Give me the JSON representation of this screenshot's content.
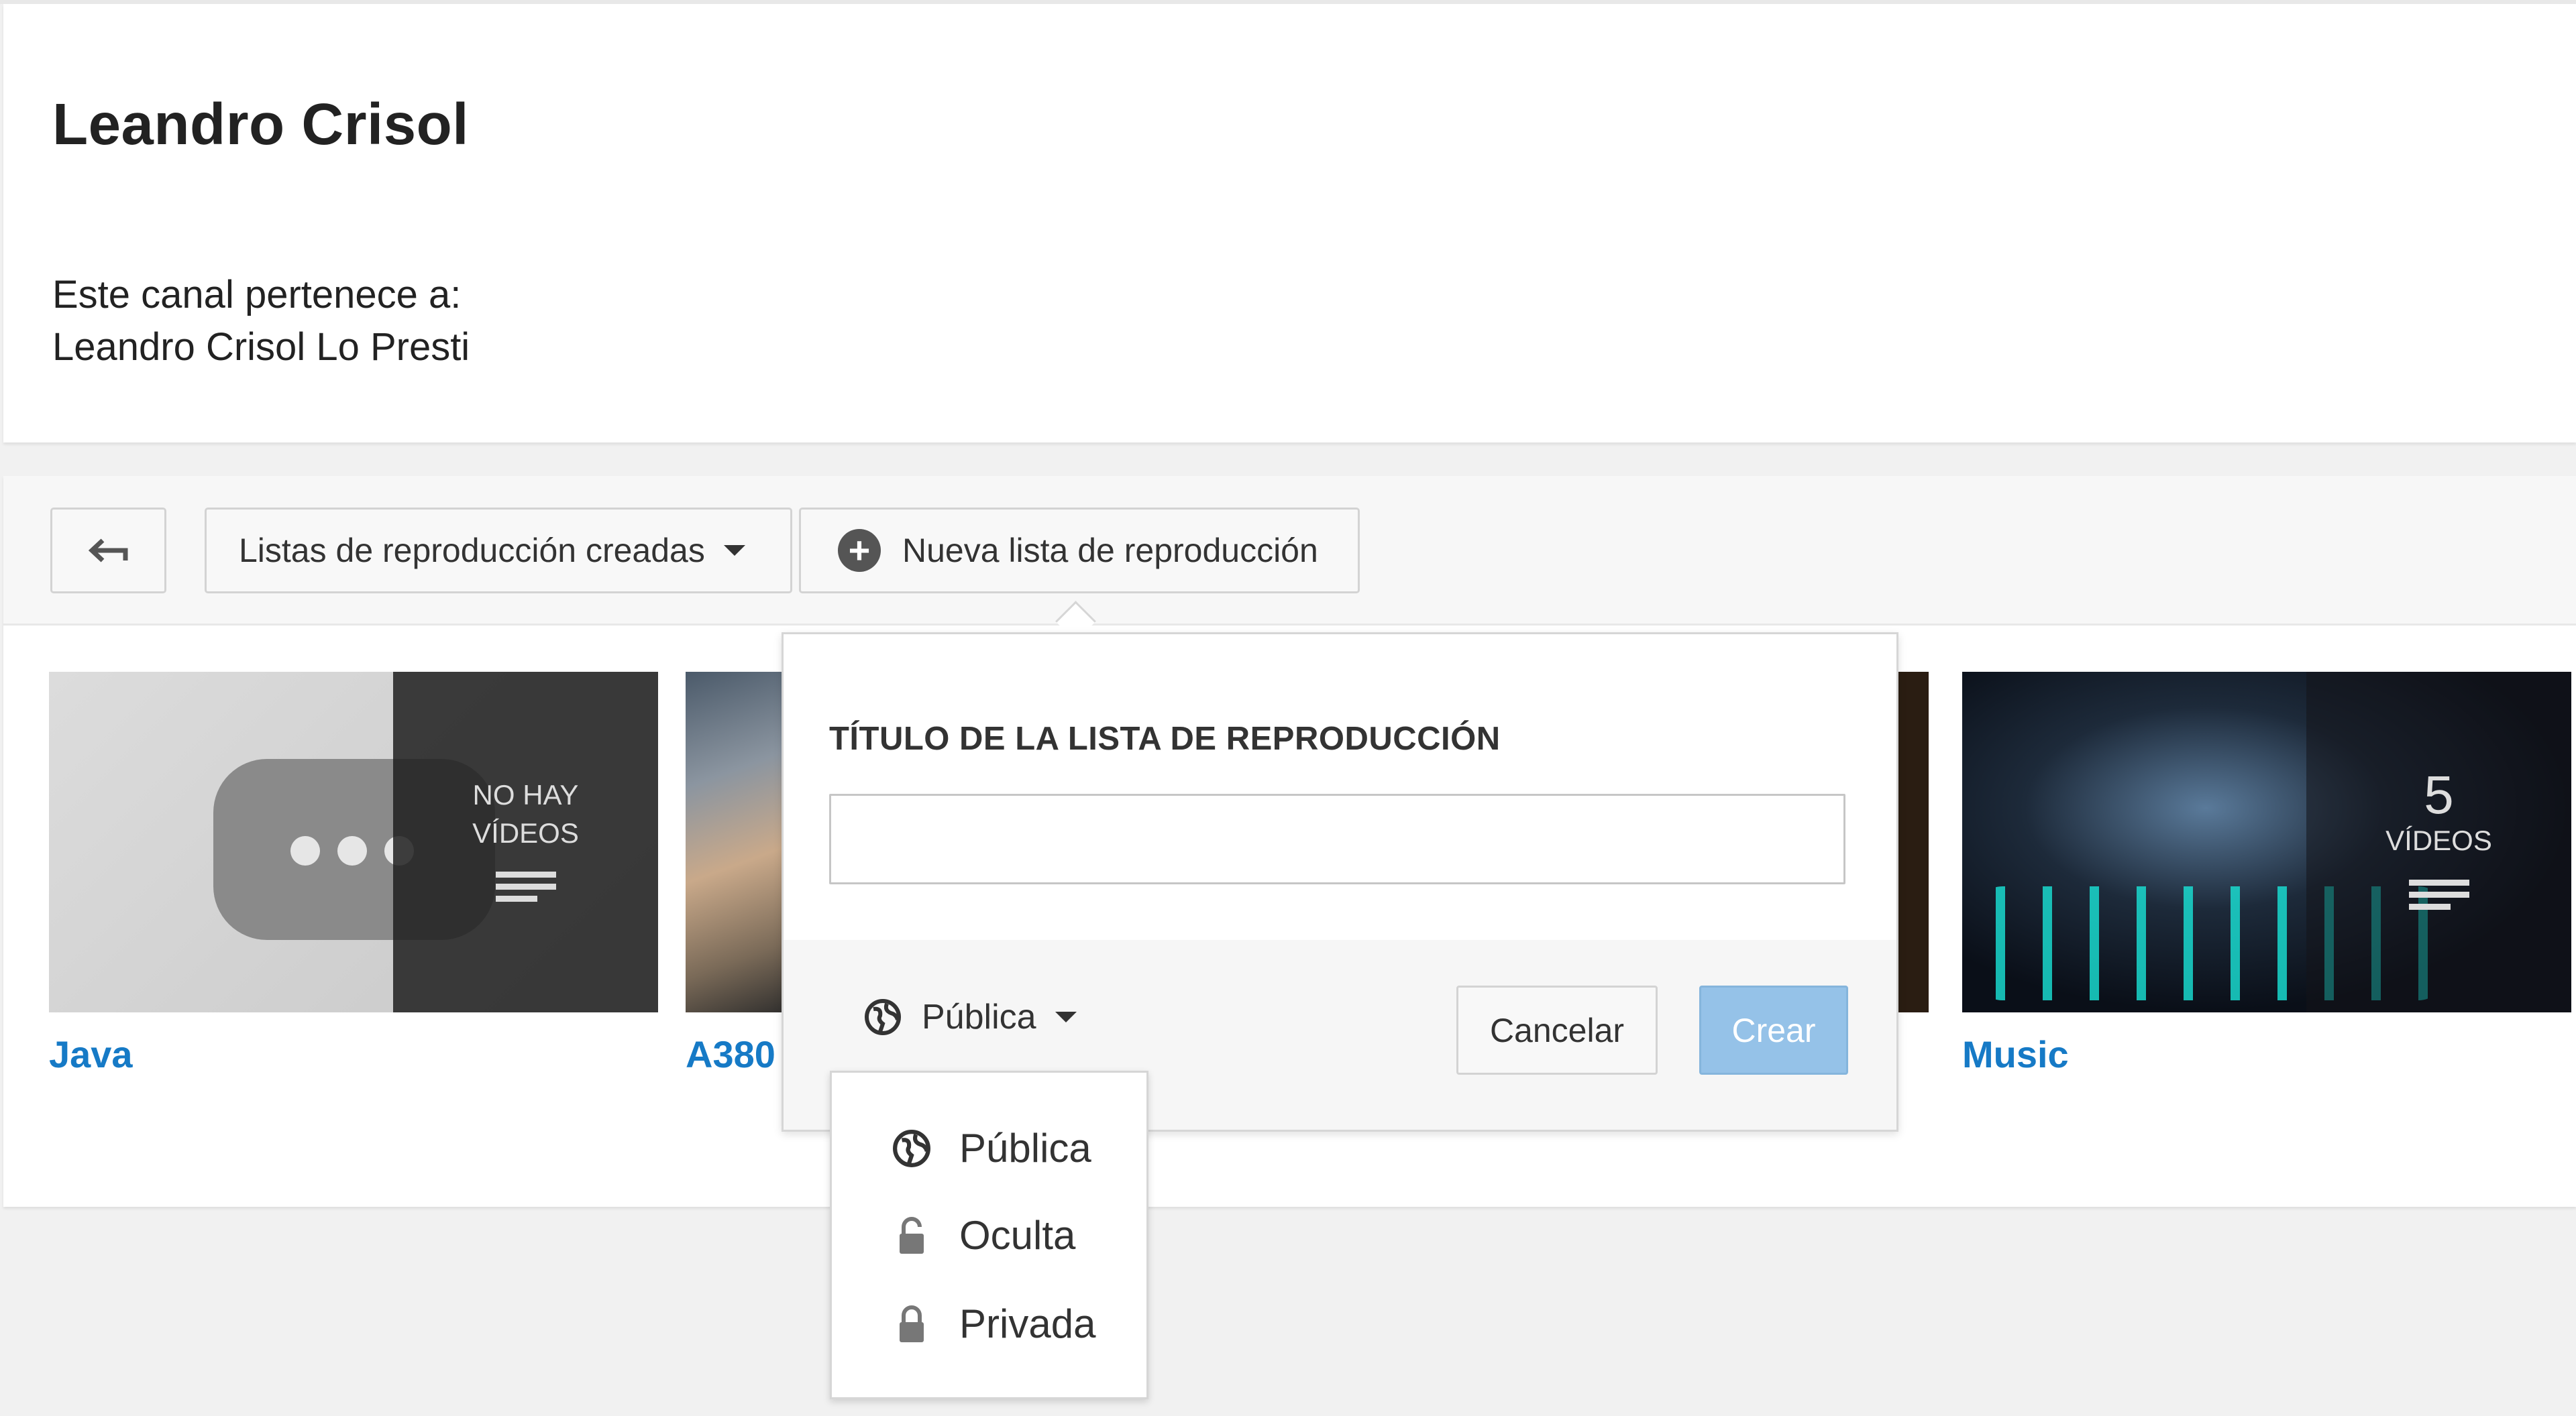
{
  "channel": {
    "name": "Leandro Crisol",
    "owner_label": "Este canal pertenece a:",
    "owner_name": "Leandro Crisol Lo Presti"
  },
  "toolbar": {
    "back_icon": "back-arrow-icon",
    "lists_button_label": "Listas de reproducción creadas",
    "new_list_button_label": "Nueva lista de reproducción"
  },
  "playlists": [
    {
      "title": "Java",
      "overlay_line1": "NO HAY",
      "overlay_line2": "VÍDEOS"
    },
    {
      "title": "A380"
    },
    {
      "title": "Music",
      "overlay_count": "5",
      "overlay_line2": "VÍDEOS"
    }
  ],
  "new_playlist_popover": {
    "title_label": "TÍTULO DE LA LISTA DE REPRODUCCIÓN",
    "title_value": "",
    "privacy_selected": "Pública",
    "cancel_label": "Cancelar",
    "create_label": "Crear"
  },
  "privacy_options": [
    {
      "label": "Pública",
      "icon": "globe-icon"
    },
    {
      "label": "Oculta",
      "icon": "unlocked-icon"
    },
    {
      "label": "Privada",
      "icon": "lock-icon"
    }
  ],
  "colors": {
    "link_blue": "#167ac6",
    "create_button_disabled": "#95c2e8"
  }
}
